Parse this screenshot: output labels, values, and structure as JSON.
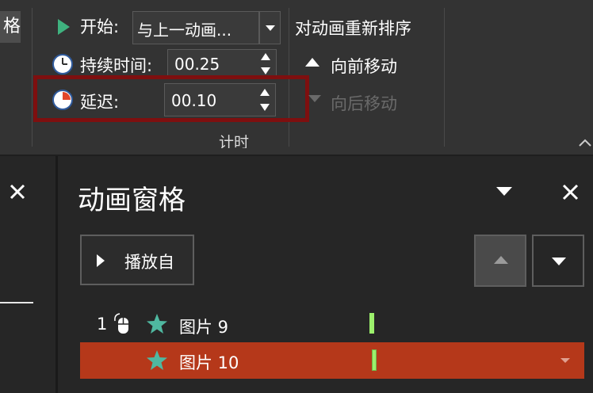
{
  "ribbon": {
    "left_stub_text": "格",
    "start": {
      "label": "开始:",
      "value": "与上一动画..."
    },
    "duration": {
      "label": "持续时间:",
      "value": "00.25"
    },
    "delay": {
      "label": "延迟:",
      "value": "00.10"
    },
    "group_label": "计时",
    "reorder": {
      "title": "对动画重新排序",
      "move_earlier": "向前移动",
      "move_later": "向后移动"
    }
  },
  "pane": {
    "title": "动画窗格",
    "play_from_label": "播放自",
    "items": [
      {
        "index": "1",
        "name": "图片 9",
        "selected": false
      },
      {
        "index": "",
        "name": "图片 10",
        "selected": true
      }
    ]
  },
  "colors": {
    "ribbon_bg": "#333333",
    "pane_bg": "#262626",
    "selected_row": "#b5381a",
    "timing_bar": "#9cf06c",
    "highlight_box": "#7e0f0f",
    "star_icon": "#4fb8a0"
  }
}
